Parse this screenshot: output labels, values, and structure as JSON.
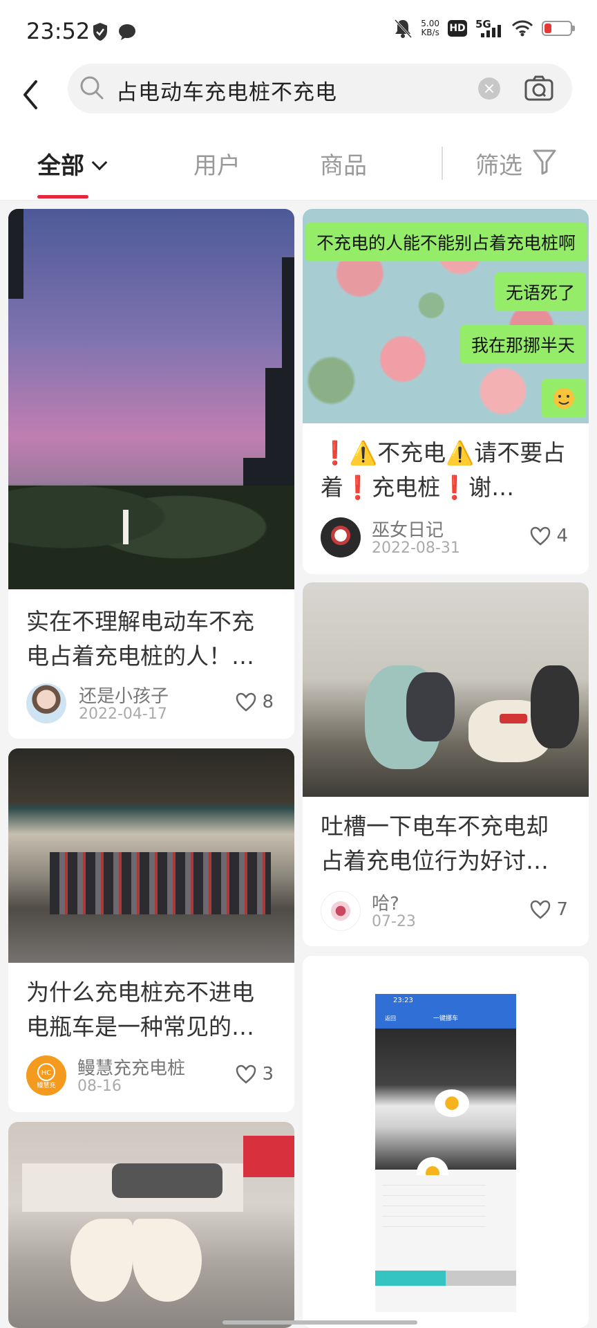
{
  "status": {
    "time": "23:52",
    "net_speed": "5.00",
    "net_unit": "KB/s",
    "hd": "HD",
    "network": "5G"
  },
  "search": {
    "query": "占电动车充电桩不充电"
  },
  "tabs": {
    "all": "全部",
    "users": "用户",
    "goods": "商品",
    "filter": "筛选"
  },
  "posts": [
    {
      "title": "实在不理解电动车不充电占着充电桩的人！…",
      "author": "还是小孩子",
      "date": "2022-04-17",
      "likes": "8"
    },
    {
      "title": "❗⚠️不充电⚠️请不要占着❗充电桩❗谢…",
      "author": "巫女日记",
      "date": "2022-08-31",
      "likes": "4",
      "bubbles": [
        "不充电的人能不能别占着充电桩啊",
        "无语死了",
        "我在那挪半天"
      ]
    },
    {
      "title": "吐槽一下电车不充电却占着充电位行为好讨…",
      "author": "哈?",
      "date": "07-23",
      "likes": "7"
    },
    {
      "title": "为什么充电桩充不进电电瓶车是一种常见的…",
      "author": "鳗慧充充电桩",
      "date": "08-16",
      "likes": "3",
      "avatar_text": "鳗慧充"
    }
  ],
  "screenshot": {
    "time": "23:23",
    "title": "一键挪车",
    "back": "返回"
  },
  "colors": {
    "accent": "#e6263d",
    "chat_bubble": "#95ec69"
  }
}
